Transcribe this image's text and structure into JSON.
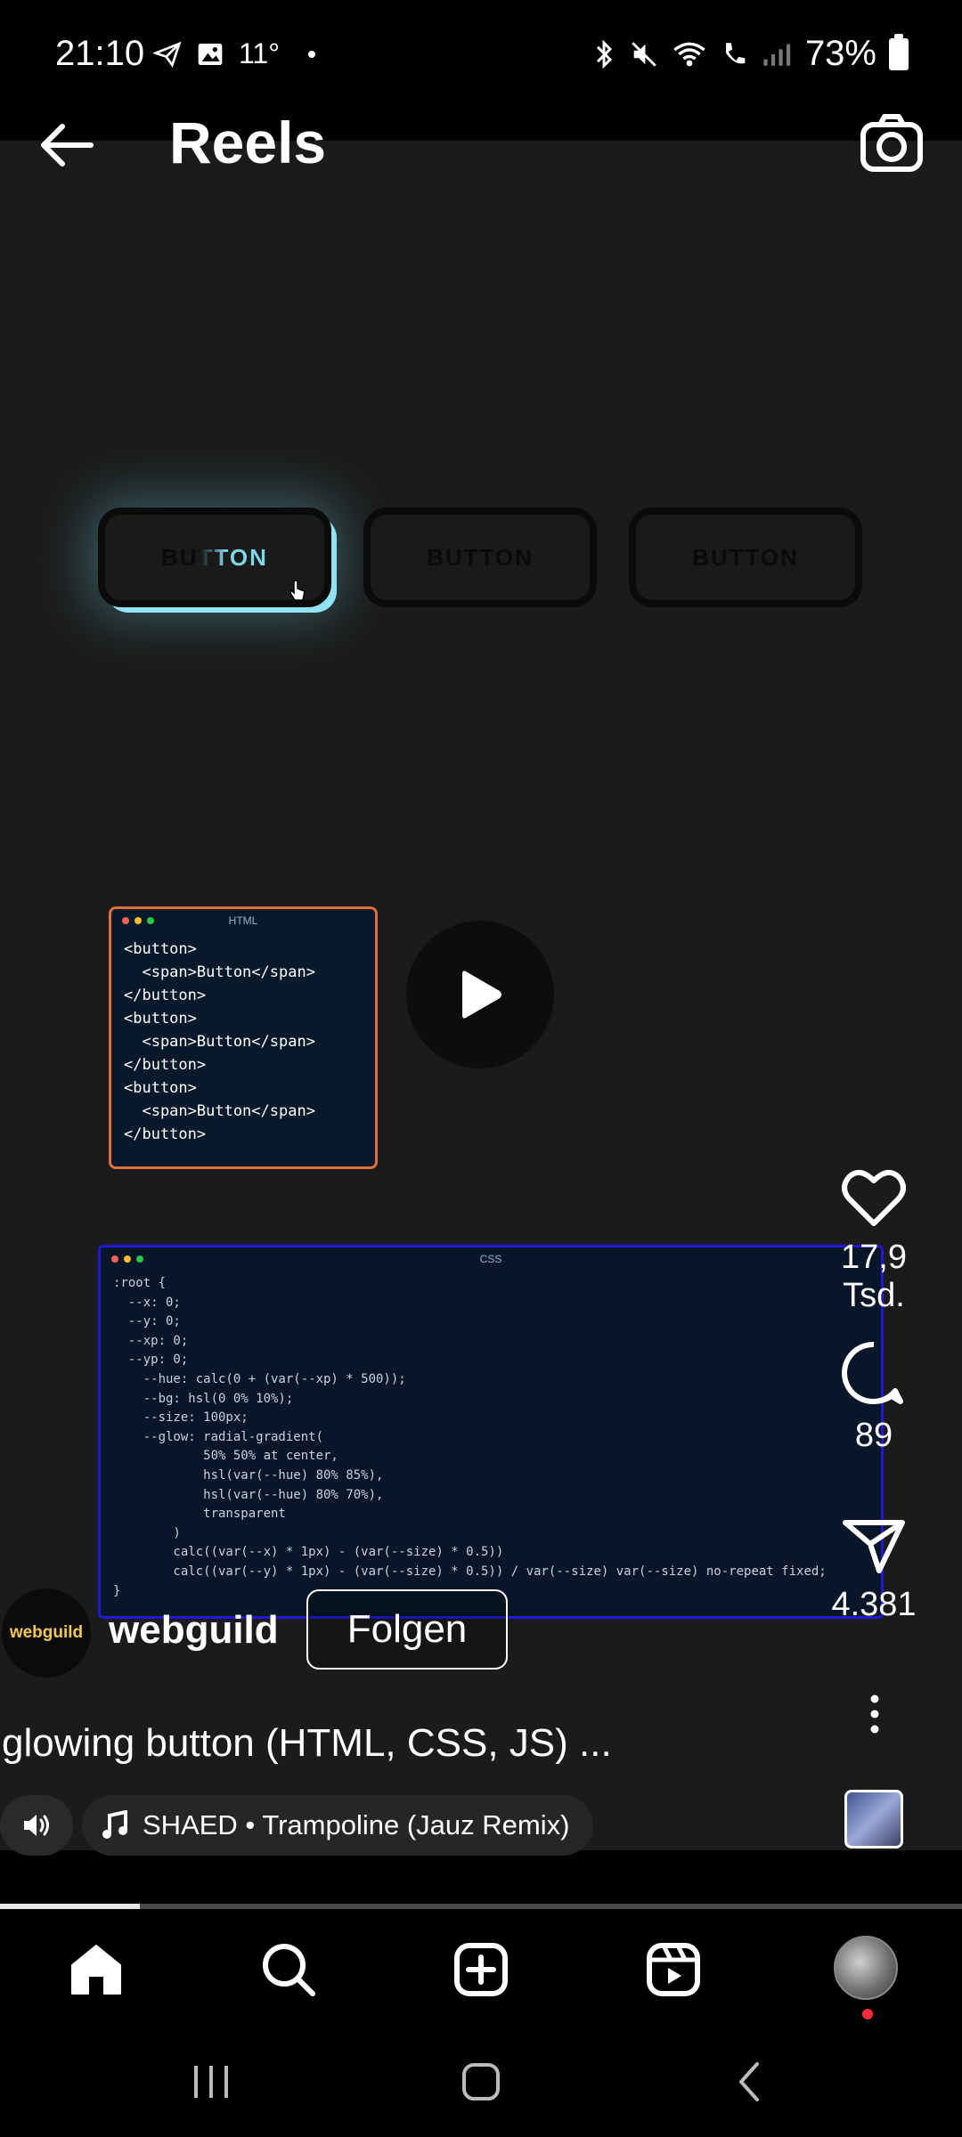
{
  "status": {
    "time": "21:10",
    "temp": "11°",
    "battery": "73%"
  },
  "header": {
    "title": "Reels"
  },
  "demo_buttons": [
    "BUTTON",
    "BUTTON",
    "BUTTON"
  ],
  "code_html": {
    "label": "HTML",
    "code": "<button>\n  <span>Button</span>\n</button>\n<button>\n  <span>Button</span>\n</button>\n<button>\n  <span>Button</span>\n</button>"
  },
  "code_css": {
    "label": "CSS",
    "code": ":root {\n  --x: 0;\n  --y: 0;\n  --xp: 0;\n  --yp: 0;\n    --hue: calc(0 + (var(--xp) * 500));\n    --bg: hsl(0 0% 10%);\n    --size: 100px;\n    --glow: radial-gradient(\n            50% 50% at center,\n            hsl(var(--hue) 80% 85%),\n            hsl(var(--hue) 80% 70%),\n            transparent\n        )\n        calc((var(--x) * 1px) - (var(--size) * 0.5))\n        calc((var(--y) * 1px) - (var(--size) * 0.5)) / var(--size) var(--size) no-repeat fixed;\n}"
  },
  "actions": {
    "likes": "17,9 Tsd.",
    "comments": "89",
    "shares": "4.381"
  },
  "post": {
    "avatar_text": "webguild",
    "username": "webguild",
    "follow_label": "Folgen",
    "caption": "glowing button (HTML, CSS, JS) ...",
    "music": "SHAED • Trampoline (Jauz Remix)"
  },
  "progress_percent": 14.5,
  "icons": {
    "back": "arrow-left-icon",
    "camera": "camera-icon",
    "play": "play-icon",
    "like": "heart-icon",
    "comment": "comment-icon",
    "share": "send-icon",
    "home": "home-icon",
    "search": "search-icon",
    "create": "plus-square-icon",
    "reels": "reels-icon"
  },
  "colors": {
    "accent_glow": "#8fe3f2",
    "html_border": "#e1703c",
    "css_border": "#2418d8",
    "notification": "#ff2b3a"
  }
}
